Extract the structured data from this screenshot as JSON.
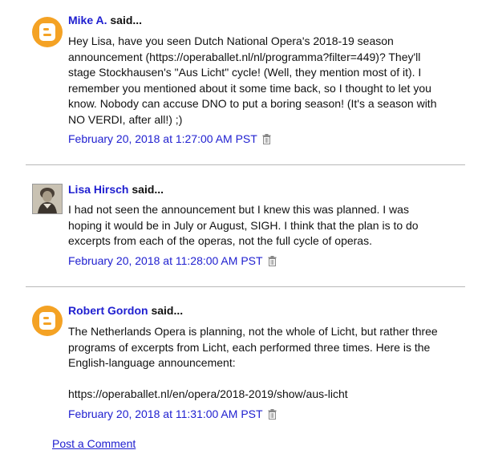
{
  "comments": [
    {
      "author": "Mike A.",
      "said": "said...",
      "avatar": "blogger-icon",
      "body": "Hey Lisa, have you seen Dutch National Opera's 2018-19 season\nannouncement (https://operaballet.nl/nl/programma?filter=449)? They'll\nstage Stockhausen's \"Aus Licht\" cycle! (Well, they mention most of it). I\nremember you mentioned about it some time back, so I thought to let you\nknow. Nobody can accuse DNO to put a boring season! (It's a season with\nNO VERDI, after all!) ;)",
      "timestamp": "February 20, 2018 at 1:27:00 AM PST"
    },
    {
      "author": "Lisa Hirsch",
      "said": "said...",
      "avatar": "photo-avatar",
      "body": "I had not seen the announcement but I knew this was planned. I was\nhoping it would be in July or August, SIGH. I think that the plan is to do\nexcerpts from each of the operas, not the full cycle of operas.",
      "timestamp": "February 20, 2018 at 11:28:00 AM PST"
    },
    {
      "author": "Robert Gordon",
      "said": "said...",
      "avatar": "blogger-icon",
      "body": "The Netherlands Opera is planning, not the whole of Licht, but rather three\nprograms of excerpts from Licht, each performed three times. Here is the\nEnglish-language announcement:\n\nhttps://operaballet.nl/en/opera/2018-2019/show/aus-licht",
      "timestamp": "February 20, 2018 at 11:31:00 AM PST"
    }
  ],
  "footer": {
    "post_comment_label": "Post a Comment"
  },
  "colors": {
    "link": "#2020d0",
    "blogger_orange": "#f4a224",
    "divider": "#b8b8b8"
  }
}
